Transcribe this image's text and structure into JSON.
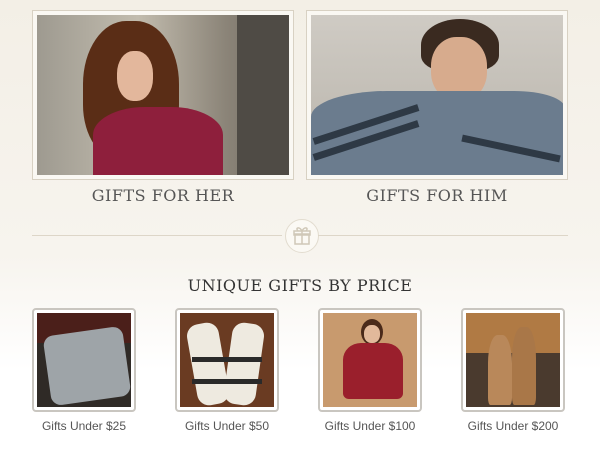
{
  "heroes": [
    {
      "caption": "GIFTS FOR HER",
      "image": "woman-red-poncho"
    },
    {
      "caption": "GIFTS FOR HIM",
      "image": "man-gray-sweater"
    }
  ],
  "divider_icon": "gift-icon",
  "section_title": "UNIQUE GIFTS BY PRICE",
  "price_tiles": [
    {
      "label": "Gifts Under $25",
      "image": "gray-scarf"
    },
    {
      "label": "Gifts Under $50",
      "image": "knit-gloves"
    },
    {
      "label": "Gifts Under $100",
      "image": "red-poncho"
    },
    {
      "label": "Gifts Under $200",
      "image": "wood-sculpture"
    }
  ]
}
